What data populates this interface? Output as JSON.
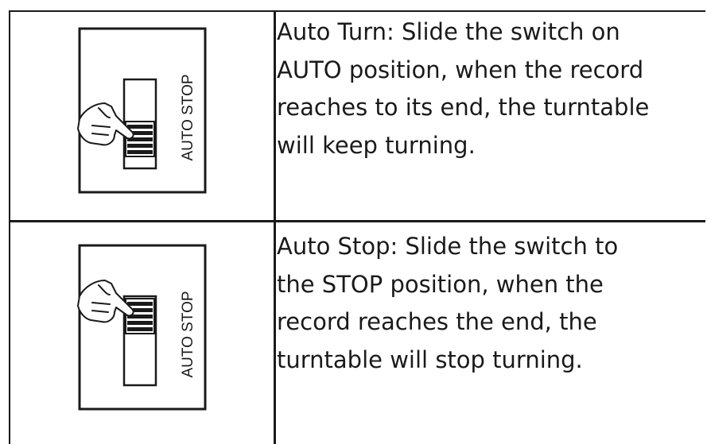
{
  "rows": [
    {
      "figure_label": "AUTO STOP",
      "switch_position": "AUTO",
      "description": "Auto Turn: Slide the switch on\nAUTO position, when the record\nreaches to its end, the turntable\nwill keep turning."
    },
    {
      "figure_label": "AUTO STOP",
      "switch_position": "STOP",
      "description": "Auto Stop: Slide the switch to\nthe STOP position, when the\nrecord reaches the end, the\nturntable will stop turning."
    }
  ]
}
